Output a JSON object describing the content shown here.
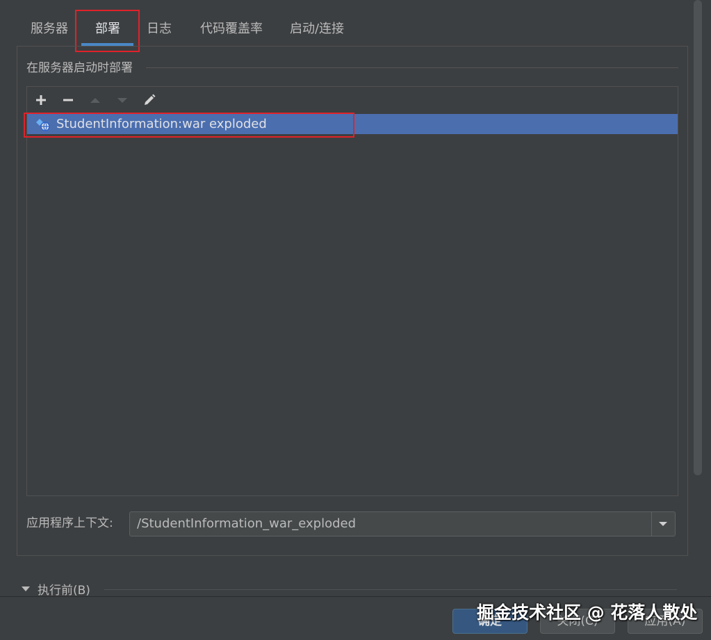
{
  "tabs": [
    {
      "label": "服务器",
      "active": false
    },
    {
      "label": "部署",
      "active": true
    },
    {
      "label": "日志",
      "active": false
    },
    {
      "label": "代码覆盖率",
      "active": false
    },
    {
      "label": "启动/连接",
      "active": false
    }
  ],
  "deploy_section": {
    "title": "在服务器启动时部署",
    "toolbar": [
      "add-icon",
      "remove-icon",
      "move-up-icon",
      "move-down-icon",
      "edit-icon"
    ],
    "items": [
      {
        "label": "StudentInformation:war exploded",
        "icon": "artifact-web-icon",
        "selected": true
      }
    ]
  },
  "context": {
    "label": "应用程序上下文:",
    "value": "/StudentInformation_war_exploded"
  },
  "before_launch": {
    "label": "执行前(B)"
  },
  "footer": {
    "ok_label": "确定",
    "close_label": "关闭(C)",
    "apply_label": "应用(A)"
  },
  "watermark": "掘金技术社区 @ 花落人散处",
  "colors": {
    "background": "#3c3f41",
    "selection": "#4b6eaf",
    "tab_underline": "#4a88c7",
    "annotation_red": "#e0222a",
    "primary_button": "#365880"
  }
}
